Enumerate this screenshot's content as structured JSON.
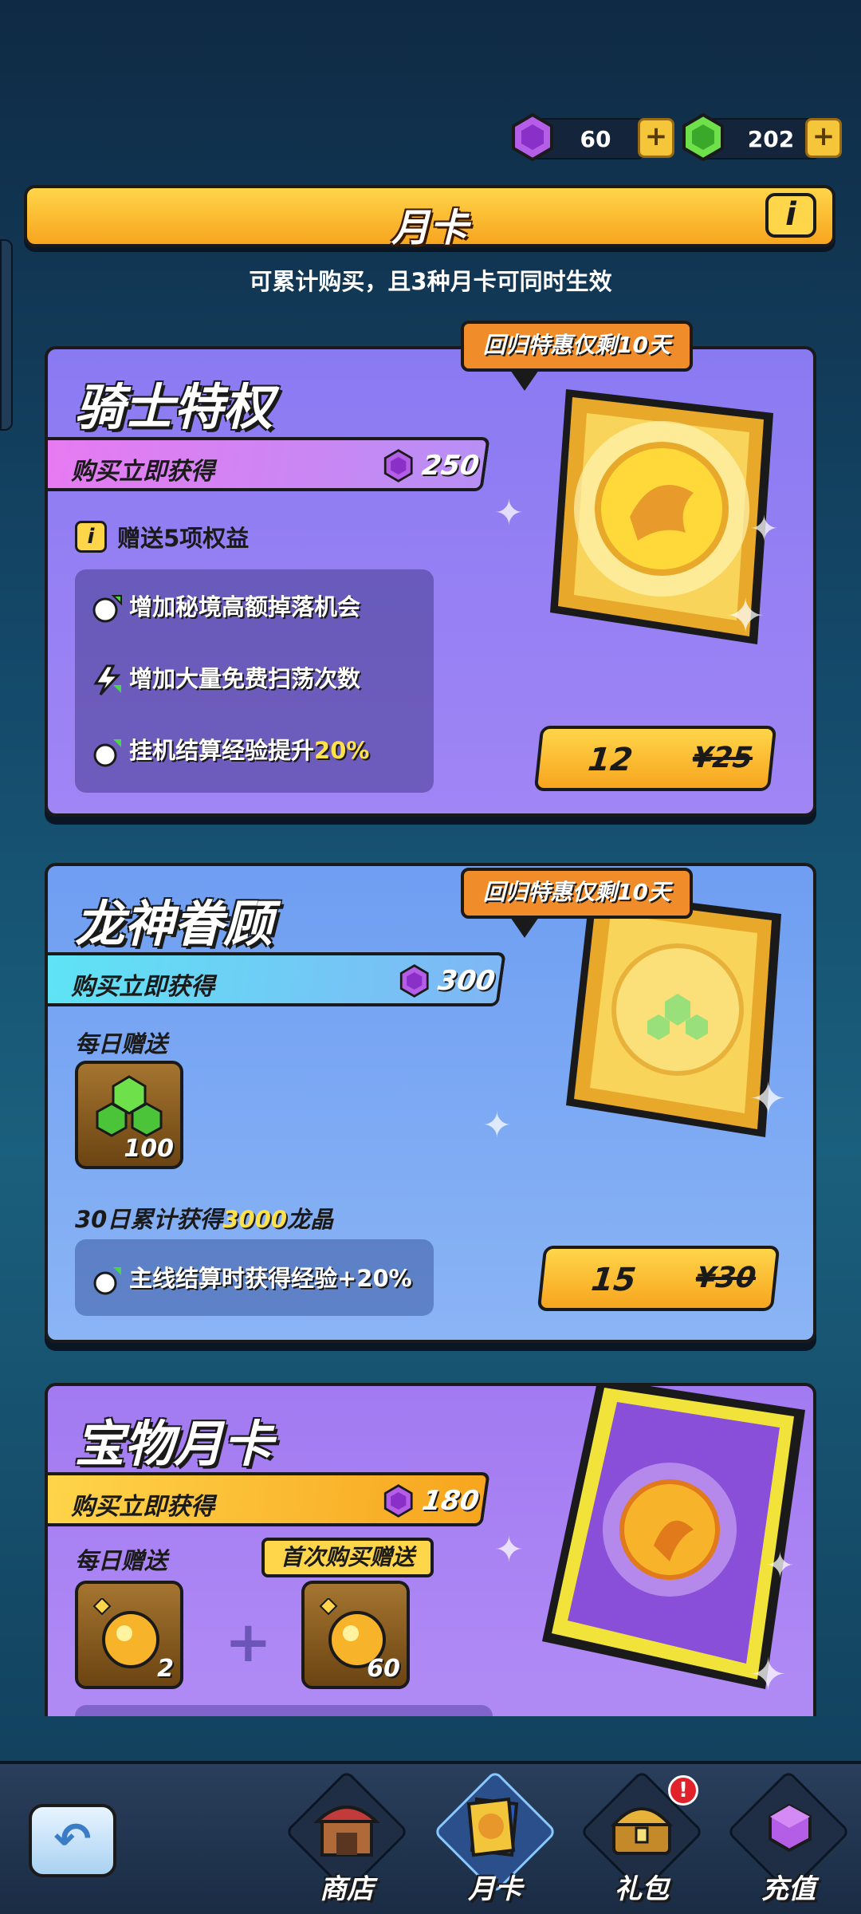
{
  "currency": {
    "purple_gem": "60",
    "green_gem": "202",
    "purple_color": "#a64bd8",
    "green_color": "#5ed43a"
  },
  "header": {
    "title": "月卡",
    "info_label": "i",
    "subtitle": "可累计购买，且3种月卡可同时生效"
  },
  "cards": [
    {
      "title": "骑士特权",
      "promo_tag": "回归特惠仅剩10天",
      "ribbon_label": "购买立即获得",
      "ribbon_value": "250",
      "gift_label": "赠送5项权益",
      "benefits": [
        {
          "text": "增加秘境高额掉落机会",
          "icon": "sword-arrow-icon"
        },
        {
          "text": "增加大量免费扫荡次数",
          "icon": "lightning-arrow-icon"
        },
        {
          "text": "挂机结算经验提升",
          "highlight": "20%",
          "icon": "bomb-arrow-icon"
        }
      ],
      "price_now": "12",
      "price_old": "¥25",
      "accent": "#8f72f0"
    },
    {
      "title": "龙神眷顾",
      "promo_tag": "回归特惠仅剩10天",
      "ribbon_label": "购买立即获得",
      "ribbon_value": "300",
      "daily_label": "每日赠送",
      "daily_item_count": "100",
      "cumulative_text_prefix": "30日累计获得",
      "cumulative_text_value": "3000",
      "cumulative_text_suffix": "龙晶",
      "benefit": "主线结算时获得经验+20%",
      "price_now": "15",
      "price_old": "¥30",
      "accent": "#6b9cf0"
    },
    {
      "title": "宝物月卡",
      "ribbon_label": "购买立即获得",
      "ribbon_value": "180",
      "daily_label": "每日赠送",
      "first_buy_label": "首次购买赠送",
      "item1_count": "2",
      "item2_count": "60",
      "accent": "#a47cf0"
    }
  ],
  "nav": {
    "items": [
      {
        "label": "商店",
        "icon": "shop-icon"
      },
      {
        "label": "月卡",
        "icon": "monthly-card-icon"
      },
      {
        "label": "礼包",
        "icon": "gift-chest-icon"
      },
      {
        "label": "充值",
        "icon": "recharge-icon"
      }
    ],
    "badge": "!"
  }
}
